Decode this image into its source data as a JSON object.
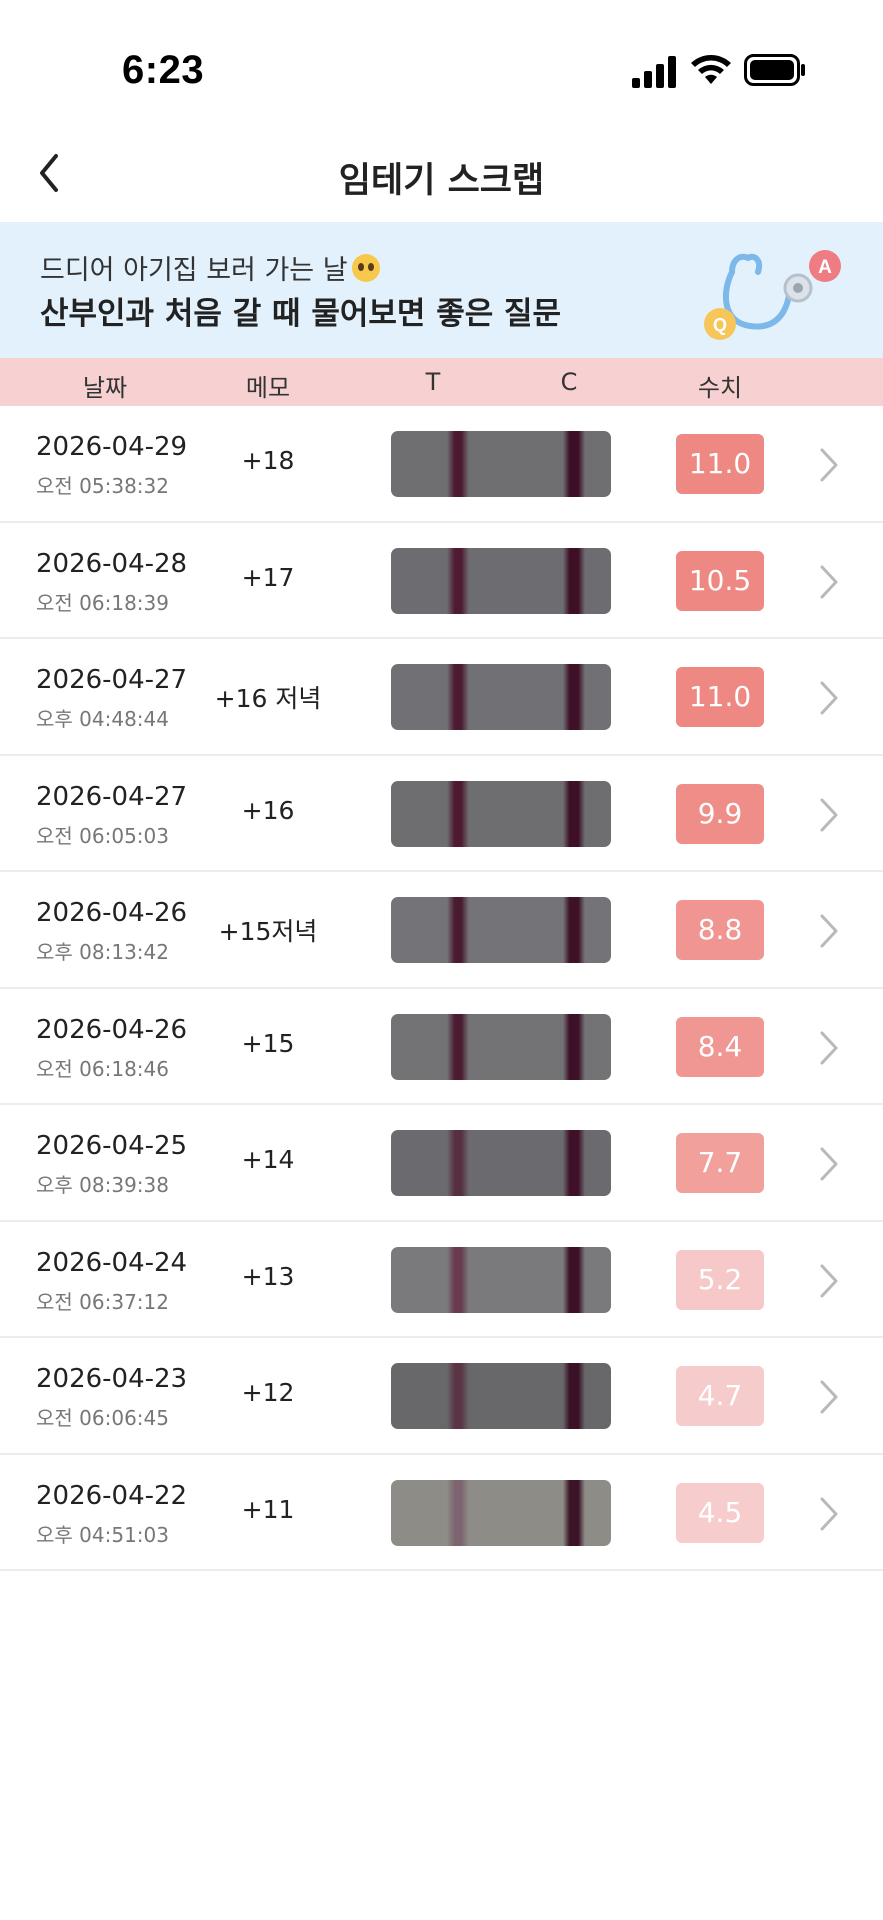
{
  "status": {
    "time": "6:23"
  },
  "nav": {
    "title": "임테기 스크랩",
    "back_icon": "chevron-left-icon"
  },
  "banner": {
    "subtitle": "드디어 아기집 보러 가는 날",
    "title": "산부인과 처음 갈 때 물어보면 좋은 질문",
    "icon": "stethoscope-qa-icon"
  },
  "table": {
    "headers": {
      "date": "날짜",
      "memo": "메모",
      "t": "T",
      "c": "C",
      "value": "수치"
    },
    "rows": [
      {
        "date": "2026-04-29",
        "time": "오전 05:38:32",
        "memo": "+18",
        "value": "11.0",
        "badge_color": "#ee8882"
      },
      {
        "date": "2026-04-28",
        "time": "오전 06:18:39",
        "memo": "+17",
        "value": "10.5",
        "badge_color": "#ee8882"
      },
      {
        "date": "2026-04-27",
        "time": "오후 04:48:44",
        "memo": "+16 저녁",
        "value": "11.0",
        "badge_color": "#ee8882"
      },
      {
        "date": "2026-04-27",
        "time": "오전 06:05:03",
        "memo": "+16",
        "value": "9.9",
        "badge_color": "#ef8d88"
      },
      {
        "date": "2026-04-26",
        "time": "오후 08:13:42",
        "memo": "+15저녁",
        "value": "8.8",
        "badge_color": "#f09591"
      },
      {
        "date": "2026-04-26",
        "time": "오전 06:18:46",
        "memo": "+15",
        "value": "8.4",
        "badge_color": "#f09793"
      },
      {
        "date": "2026-04-25",
        "time": "오후 08:39:38",
        "memo": "+14",
        "value": "7.7",
        "badge_color": "#f1a09c"
      },
      {
        "date": "2026-04-24",
        "time": "오전 06:37:12",
        "memo": "+13",
        "value": "5.2",
        "badge_color": "#f6c8c8"
      },
      {
        "date": "2026-04-23",
        "time": "오전 06:06:45",
        "memo": "+12",
        "value": "4.7",
        "badge_color": "#f6cbcb"
      },
      {
        "date": "2026-04-22",
        "time": "오후 04:51:03",
        "memo": "+11",
        "value": "4.5",
        "badge_color": "#f6cccc"
      }
    ]
  },
  "colors": {
    "header_bg": "#f7d1d2",
    "banner_bg": "#e3f1fc"
  }
}
